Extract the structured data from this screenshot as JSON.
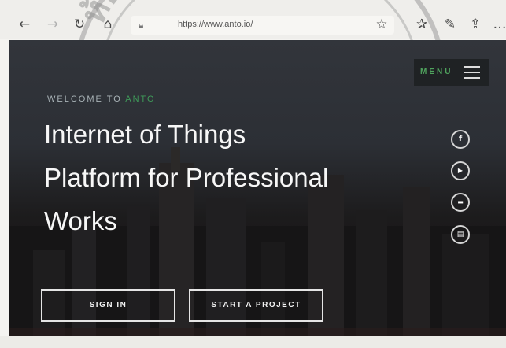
{
  "browser": {
    "url": "https://www.anto.io/",
    "icons": [
      "back-icon",
      "forward-icon",
      "reload-icon",
      "home-icon",
      "lock-icon",
      "star-icon",
      "favorites-icon",
      "pen-icon",
      "share-icon",
      "more-icon"
    ]
  },
  "watermark": {
    "text": "ห้องสมุดเกล้าเจ้าคุณ"
  },
  "hero": {
    "menu_label": "MENU",
    "welcome_prefix": "WELCOME TO ",
    "welcome_brand": "ANTO",
    "headline_line1": "Internet of Things",
    "headline_line2": "Platform for Professional",
    "headline_line3": "Works",
    "social": [
      {
        "icon": "facebook-icon",
        "glyph": "f"
      },
      {
        "icon": "youtube-icon",
        "glyph": "▶"
      },
      {
        "icon": "chat-icon",
        "glyph": "▬"
      },
      {
        "icon": "document-icon",
        "glyph": "▤"
      }
    ],
    "buttons": {
      "sign_in": "SIGN IN",
      "start_project": "START A PROJECT"
    }
  },
  "colors": {
    "brand_green": "#3f9a59",
    "hero_bg": "#2c2f35",
    "text_light": "#f7f7f7"
  }
}
